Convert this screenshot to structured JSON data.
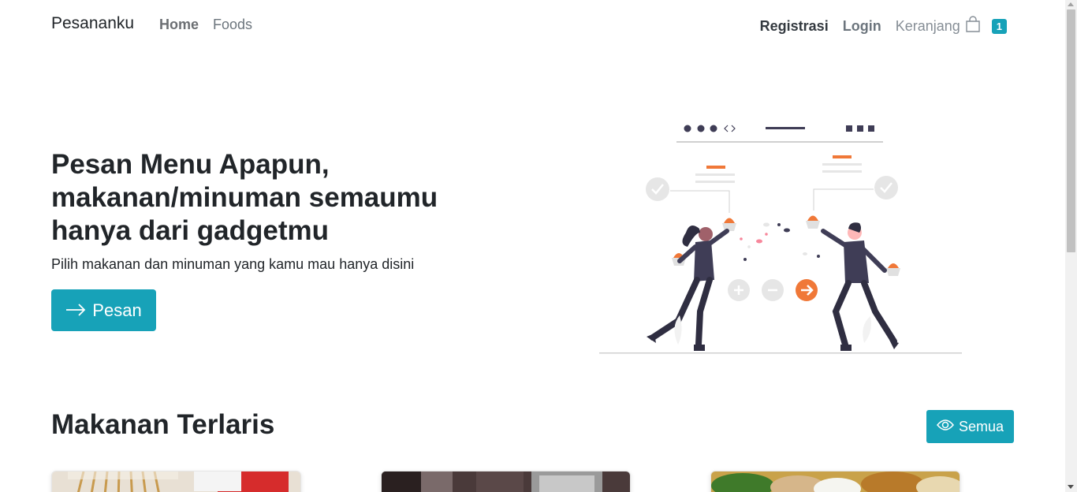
{
  "navbar": {
    "brand": "Pesananku",
    "links": [
      {
        "label": "Home"
      },
      {
        "label": "Foods"
      }
    ],
    "register_label": "Registrasi",
    "login_label": "Login",
    "cart_label": "Keranjang",
    "cart_count": "1",
    "cart_icon": "shopping-bag-icon"
  },
  "hero": {
    "title_bold": "Pesan Menu Apapun",
    "title_rest": ", makanan/minuman semaumu hanya dari gadgetmu",
    "subtitle": "Pilih makanan dan minuman yang kamu mau hanya disini",
    "order_button": "Pesan",
    "order_icon": "arrow-right-icon"
  },
  "bestseller": {
    "title_normal": "Makanan ",
    "title_bold": "Terlaris",
    "see_all_button": "Semua",
    "see_all_icon": "eye-icon",
    "cards": [
      {
        "image": "sate-food-image"
      },
      {
        "image": "drink-food-image"
      },
      {
        "image": "rice-dish-food-image"
      }
    ]
  },
  "colors": {
    "accent": "#17a2b8",
    "illustration_orange": "#f07838",
    "illustration_dark": "#3f3d56"
  }
}
